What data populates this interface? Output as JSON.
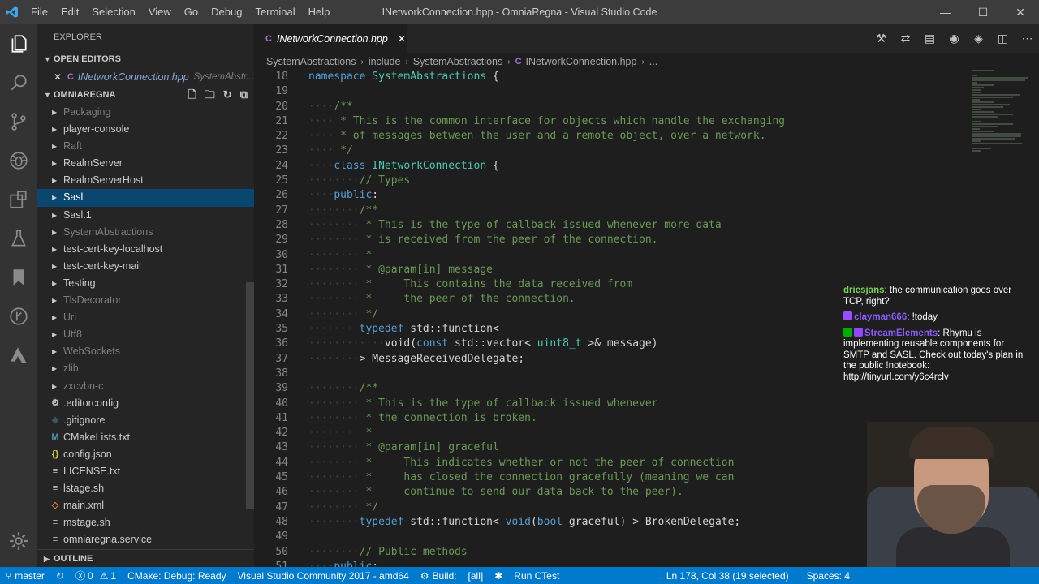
{
  "titlebar": {
    "app_icon": "vscode-logo-icon",
    "menu": [
      "File",
      "Edit",
      "Selection",
      "View",
      "Go",
      "Debug",
      "Terminal",
      "Help"
    ],
    "window_title": "INetworkConnection.hpp - OmniaRegna - Visual Studio Code",
    "controls": {
      "minimize": "—",
      "maximize": "☐",
      "close": "✕"
    }
  },
  "activitybar": {
    "icons": [
      "files-icon",
      "search-icon",
      "source-control-icon",
      "debug-icon",
      "extensions-icon",
      "test-flask-icon",
      "bookmark-icon",
      "git-graph-icon",
      "azure-icon",
      "settings-gear-icon"
    ]
  },
  "sidebar": {
    "header": "EXPLORER",
    "open_editors": {
      "title": "OPEN EDITORS",
      "items": [
        {
          "name": "INetworkConnection.hpp",
          "path": "SystemAbstr..."
        }
      ]
    },
    "project": {
      "title": "OMNIAREGNA",
      "actions": [
        "new-file-icon",
        "new-folder-icon",
        "refresh-icon",
        "collapse-all-icon"
      ],
      "items": [
        {
          "label": "Packaging",
          "type": "folder",
          "dim": true
        },
        {
          "label": "player-console",
          "type": "folder",
          "dim": false
        },
        {
          "label": "Raft",
          "type": "folder",
          "dim": true
        },
        {
          "label": "RealmServer",
          "type": "folder",
          "dim": false
        },
        {
          "label": "RealmServerHost",
          "type": "folder",
          "dim": false
        },
        {
          "label": "Sasl",
          "type": "folder",
          "dim": false,
          "selected": true
        },
        {
          "label": "Sasl.1",
          "type": "folder",
          "dim": false
        },
        {
          "label": "SystemAbstractions",
          "type": "folder",
          "dim": true
        },
        {
          "label": "test-cert-key-localhost",
          "type": "folder",
          "dim": false
        },
        {
          "label": "test-cert-key-mail",
          "type": "folder",
          "dim": false
        },
        {
          "label": "Testing",
          "type": "folder",
          "dim": false
        },
        {
          "label": "TlsDecorator",
          "type": "folder",
          "dim": true
        },
        {
          "label": "Uri",
          "type": "folder",
          "dim": true
        },
        {
          "label": "Utf8",
          "type": "folder",
          "dim": true
        },
        {
          "label": "WebSockets",
          "type": "folder",
          "dim": true
        },
        {
          "label": "zlib",
          "type": "folder",
          "dim": true
        },
        {
          "label": "zxcvbn-c",
          "type": "folder",
          "dim": true
        },
        {
          "label": ".editorconfig",
          "type": "file",
          "icon": "⚙",
          "icon_color": "#c5c5c5"
        },
        {
          "label": ".gitignore",
          "type": "file",
          "icon": "◆",
          "icon_color": "#41535b"
        },
        {
          "label": "CMakeLists.txt",
          "type": "file",
          "icon": "M",
          "icon_color": "#519aba"
        },
        {
          "label": "config.json",
          "type": "file",
          "icon": "{}",
          "icon_color": "#cbcb41"
        },
        {
          "label": "LICENSE.txt",
          "type": "file",
          "icon": "≡",
          "icon_color": "#c5c5c5"
        },
        {
          "label": "lstage.sh",
          "type": "file",
          "icon": "≡",
          "icon_color": "#c5c5c5"
        },
        {
          "label": "main.xml",
          "type": "file",
          "icon": "◇",
          "icon_color": "#e37933"
        },
        {
          "label": "mstage.sh",
          "type": "file",
          "icon": "≡",
          "icon_color": "#c5c5c5"
        },
        {
          "label": "omniaregna.service",
          "type": "file",
          "icon": "≡",
          "icon_color": "#c5c5c5"
        }
      ]
    },
    "outline": "OUTLINE"
  },
  "editor": {
    "tab": {
      "label": "INetworkConnection.hpp",
      "close": "✕"
    },
    "actions": [
      "run-icon",
      "compare-icon",
      "open-preview-icon",
      "toggle-icon",
      "git-icon",
      "split-editor-icon",
      "more-icon"
    ],
    "breadcrumb": [
      "SystemAbstractions",
      "include",
      "SystemAbstractions",
      "INetworkConnection.hpp",
      "..."
    ],
    "code_lines": [
      {
        "n": "18",
        "segs": [
          [
            "k",
            "namespace"
          ],
          [
            "p",
            " "
          ],
          [
            "t",
            "SystemAbstractions"
          ],
          [
            "p",
            " {"
          ]
        ]
      },
      {
        "n": "19",
        "segs": []
      },
      {
        "n": "20",
        "segs": [
          [
            "w",
            "····"
          ],
          [
            "c",
            "/**"
          ]
        ]
      },
      {
        "n": "21",
        "segs": [
          [
            "w",
            "····"
          ],
          [
            "c",
            " * This is the common interface for objects which handle the exchanging"
          ]
        ]
      },
      {
        "n": "22",
        "segs": [
          [
            "w",
            "····"
          ],
          [
            "c",
            " * of messages between the user and a remote object, over a network."
          ]
        ]
      },
      {
        "n": "23",
        "segs": [
          [
            "w",
            "····"
          ],
          [
            "c",
            " */"
          ]
        ]
      },
      {
        "n": "24",
        "segs": [
          [
            "w",
            "····"
          ],
          [
            "k",
            "class"
          ],
          [
            "p",
            " "
          ],
          [
            "t",
            "INetworkConnection"
          ],
          [
            "p",
            " {"
          ]
        ]
      },
      {
        "n": "25",
        "segs": [
          [
            "w",
            "····"
          ],
          [
            "w",
            "····"
          ],
          [
            "c",
            "// Types"
          ]
        ]
      },
      {
        "n": "26",
        "segs": [
          [
            "w",
            "····"
          ],
          [
            "k",
            "public"
          ],
          [
            "p",
            ":"
          ]
        ]
      },
      {
        "n": "27",
        "segs": [
          [
            "w",
            "········"
          ],
          [
            "c",
            "/**"
          ]
        ]
      },
      {
        "n": "28",
        "segs": [
          [
            "w",
            "········"
          ],
          [
            "c",
            " * This is the type of callback issued whenever more data"
          ]
        ]
      },
      {
        "n": "29",
        "segs": [
          [
            "w",
            "········"
          ],
          [
            "c",
            " * is received from the peer of the connection."
          ]
        ]
      },
      {
        "n": "30",
        "segs": [
          [
            "w",
            "········"
          ],
          [
            "c",
            " *"
          ]
        ]
      },
      {
        "n": "31",
        "segs": [
          [
            "w",
            "········"
          ],
          [
            "c",
            " * @param[in] message"
          ]
        ]
      },
      {
        "n": "32",
        "segs": [
          [
            "w",
            "········"
          ],
          [
            "c",
            " *     This contains the data received from"
          ]
        ]
      },
      {
        "n": "33",
        "segs": [
          [
            "w",
            "········"
          ],
          [
            "c",
            " *     the peer of the connection."
          ]
        ]
      },
      {
        "n": "34",
        "segs": [
          [
            "w",
            "········"
          ],
          [
            "c",
            " */"
          ]
        ]
      },
      {
        "n": "35",
        "segs": [
          [
            "w",
            "········"
          ],
          [
            "k",
            "typedef"
          ],
          [
            "p",
            " std::function<"
          ]
        ]
      },
      {
        "n": "36",
        "segs": [
          [
            "w",
            "············"
          ],
          [
            "p",
            "void("
          ],
          [
            "k",
            "const"
          ],
          [
            "p",
            " std::vector< "
          ],
          [
            "t",
            "uint8_t"
          ],
          [
            "p",
            " >& message)"
          ]
        ]
      },
      {
        "n": "37",
        "segs": [
          [
            "w",
            "········"
          ],
          [
            "p",
            "> MessageReceivedDelegate;"
          ]
        ]
      },
      {
        "n": "38",
        "segs": []
      },
      {
        "n": "39",
        "segs": [
          [
            "w",
            "········"
          ],
          [
            "c",
            "/**"
          ]
        ]
      },
      {
        "n": "40",
        "segs": [
          [
            "w",
            "········"
          ],
          [
            "c",
            " * This is the type of callback issued whenever"
          ]
        ]
      },
      {
        "n": "41",
        "segs": [
          [
            "w",
            "········"
          ],
          [
            "c",
            " * the connection is broken."
          ]
        ]
      },
      {
        "n": "42",
        "segs": [
          [
            "w",
            "········"
          ],
          [
            "c",
            " *"
          ]
        ]
      },
      {
        "n": "43",
        "segs": [
          [
            "w",
            "········"
          ],
          [
            "c",
            " * @param[in] graceful"
          ]
        ]
      },
      {
        "n": "44",
        "segs": [
          [
            "w",
            "········"
          ],
          [
            "c",
            " *     This indicates whether or not the peer of connection"
          ]
        ]
      },
      {
        "n": "45",
        "segs": [
          [
            "w",
            "········"
          ],
          [
            "c",
            " *     has closed the connection gracefully (meaning we can"
          ]
        ]
      },
      {
        "n": "46",
        "segs": [
          [
            "w",
            "········"
          ],
          [
            "c",
            " *     continue to send our data back to the peer)."
          ]
        ]
      },
      {
        "n": "47",
        "segs": [
          [
            "w",
            "········"
          ],
          [
            "c",
            " */"
          ]
        ]
      },
      {
        "n": "48",
        "segs": [
          [
            "w",
            "········"
          ],
          [
            "k",
            "typedef"
          ],
          [
            "p",
            " std::function< "
          ],
          [
            "k",
            "void"
          ],
          [
            "p",
            "("
          ],
          [
            "k",
            "bool"
          ],
          [
            "p",
            " graceful) > BrokenDelegate;"
          ]
        ]
      },
      {
        "n": "49",
        "segs": []
      },
      {
        "n": "50",
        "segs": [
          [
            "w",
            "········"
          ],
          [
            "c",
            "// Public methods"
          ]
        ]
      },
      {
        "n": "51",
        "segs": [
          [
            "w",
            "····"
          ],
          [
            "k",
            "public"
          ],
          [
            "p",
            ":"
          ]
        ]
      }
    ]
  },
  "chat": [
    {
      "user": "driesjans",
      "user_color": "#7bd35a",
      "badges": [],
      "text": "the communication goes over TCP, right?"
    },
    {
      "user": "clayman666",
      "user_color": "#8a5cf5",
      "badges": [
        "#9b4dff"
      ],
      "text": "!today"
    },
    {
      "user": "StreamElements",
      "user_color": "#8a5cf5",
      "badges": [
        "#00ad03",
        "#9146ff"
      ],
      "text": "Rhymu is implementing reusable components for SMTP and SASL. Check out today's plan in the public !notebook: http://tinyurl.com/y6c4rclv"
    }
  ],
  "statusbar": {
    "branch": "master",
    "sync_icon": "sync-icon",
    "errors": "0",
    "warnings": "1",
    "cmake": "CMake: Debug: Ready",
    "kit": "Visual Studio Community 2017 - amd64",
    "build": "Build:",
    "target": "[all]",
    "ctest": "Run CTest",
    "cursor": "Ln 178, Col 38 (19 selected)",
    "spaces": "Spaces: 4"
  }
}
